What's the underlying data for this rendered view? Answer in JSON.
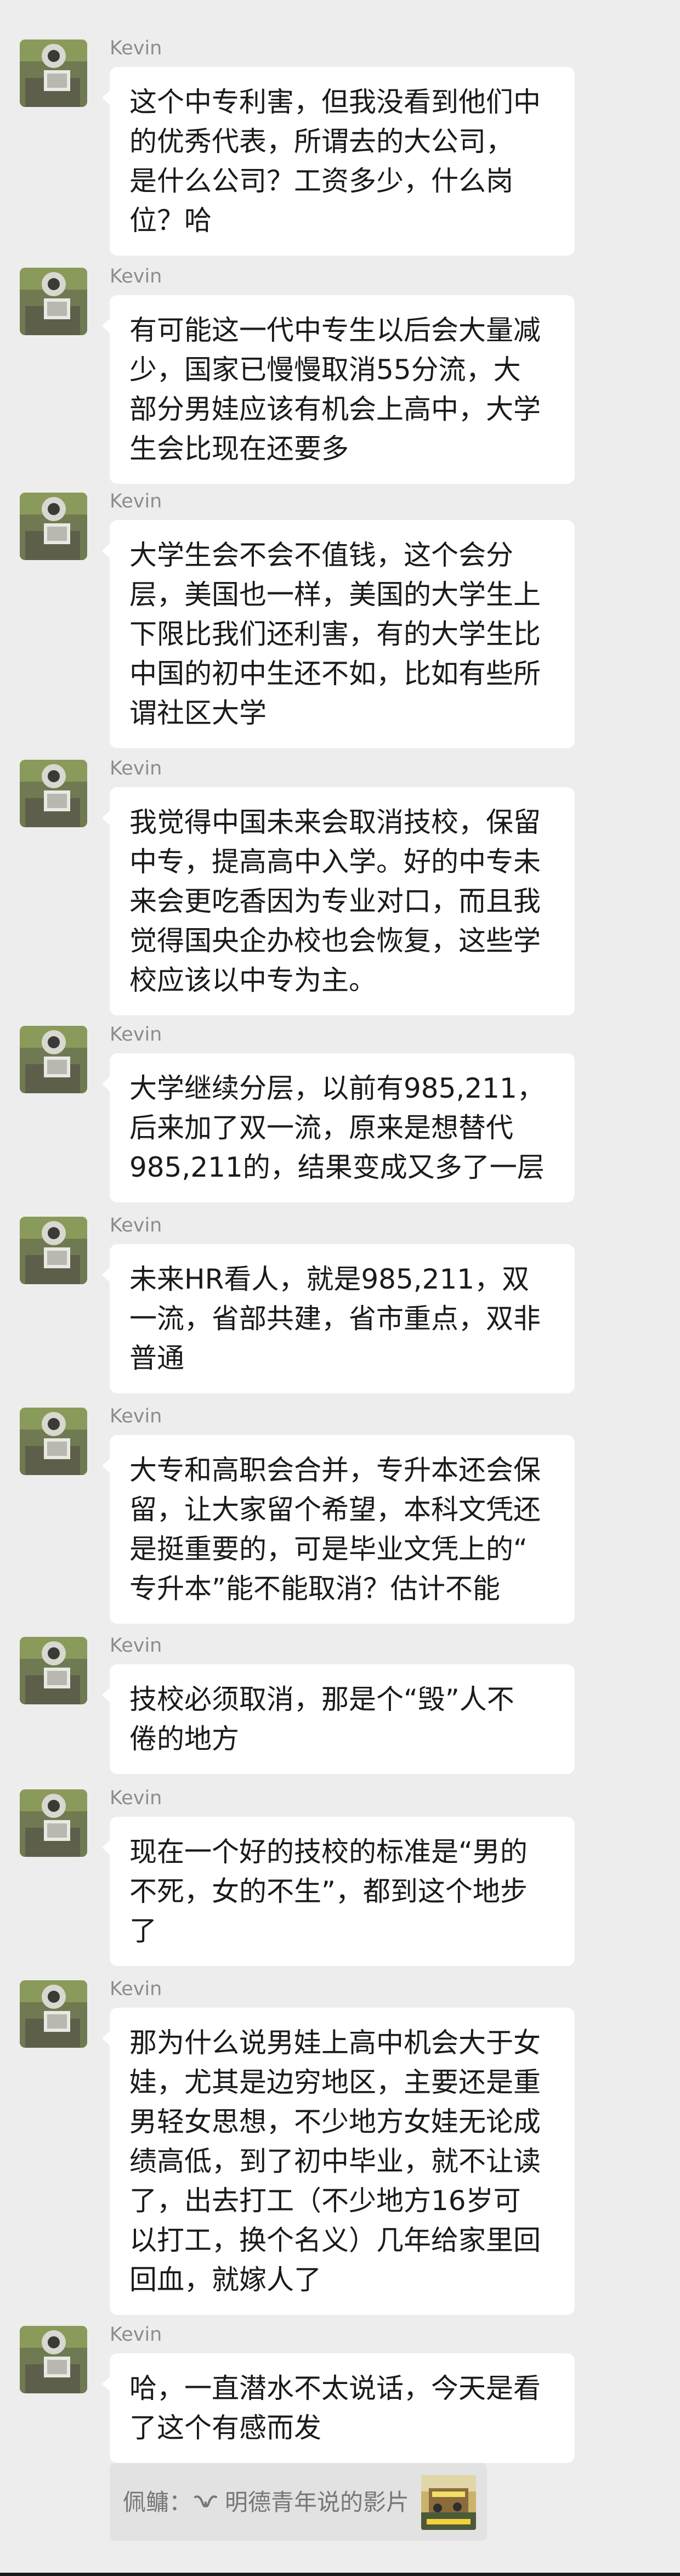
{
  "chat": {
    "messages": [
      {
        "sender": "Kevin",
        "text": "这个中专利害，但我没看到他们中\n的优秀代表，所谓去的大公司，\n是什么公司？工资多少，什么岗\n位？哈"
      },
      {
        "sender": "Kevin",
        "text": "有可能这一代中专生以后会大量减\n少，国家已慢慢取消55分流，大\n部分男娃应该有机会上高中，大学\n生会比现在还要多"
      },
      {
        "sender": "Kevin",
        "text": "大学生会不会不值钱，这个会分\n层，美国也一样，美国的大学生上\n下限比我们还利害，有的大学生比\n中国的初中生还不如，比如有些所\n谓社区大学"
      },
      {
        "sender": "Kevin",
        "text": "我觉得中国未来会取消技校，保留\n中专，提高高中入学。好的中专未\n来会更吃香因为专业对口，而且我\n觉得国央企办校也会恢复，这些学\n校应该以中专为主。"
      },
      {
        "sender": "Kevin",
        "text": "大学继续分层，以前有985,211，\n后来加了双一流，原来是想替代\n985,211的，结果变成又多了一层"
      },
      {
        "sender": "Kevin",
        "text": "未来HR看人，就是985,211，双\n一流，省部共建，省市重点，双非\n普通"
      },
      {
        "sender": "Kevin",
        "text": "大专和高职会合并，专升本还会保\n留，让大家留个希望，本科文凭还\n是挺重要的，可是毕业文凭上的“\n专升本”能不能取消？估计不能"
      },
      {
        "sender": "Kevin",
        "text": "技校必须取消，那是个“毁”人不\n倦的地方"
      },
      {
        "sender": "Kevin",
        "text": "现在一个好的技校的标准是“男的\n不死，女的不生”，都到这个地步\n了"
      },
      {
        "sender": "Kevin",
        "text": "那为什么说男娃上高中机会大于女\n娃，尤其是边穷地区，主要还是重\n男轻女思想，不少地方女娃无论成\n绩高低，到了初中毕业，就不让读\n了，出去打工（不少地方16岁可\n以打工，换个名义）几年给家里回\n回血，就嫁人了"
      },
      {
        "sender": "Kevin",
        "text": "哈，一直潜水不太说话，今天是看\n了这个有感而发"
      }
    ],
    "quote": {
      "sender": "佩鳙：",
      "icon": "wechat-channels-icon",
      "title": "明德青年说的影片"
    }
  },
  "colors": {
    "background": "#ededed",
    "bubble": "#ffffff",
    "quote_background": "#e2e2e2",
    "sender_text": "#8c8c8c"
  }
}
